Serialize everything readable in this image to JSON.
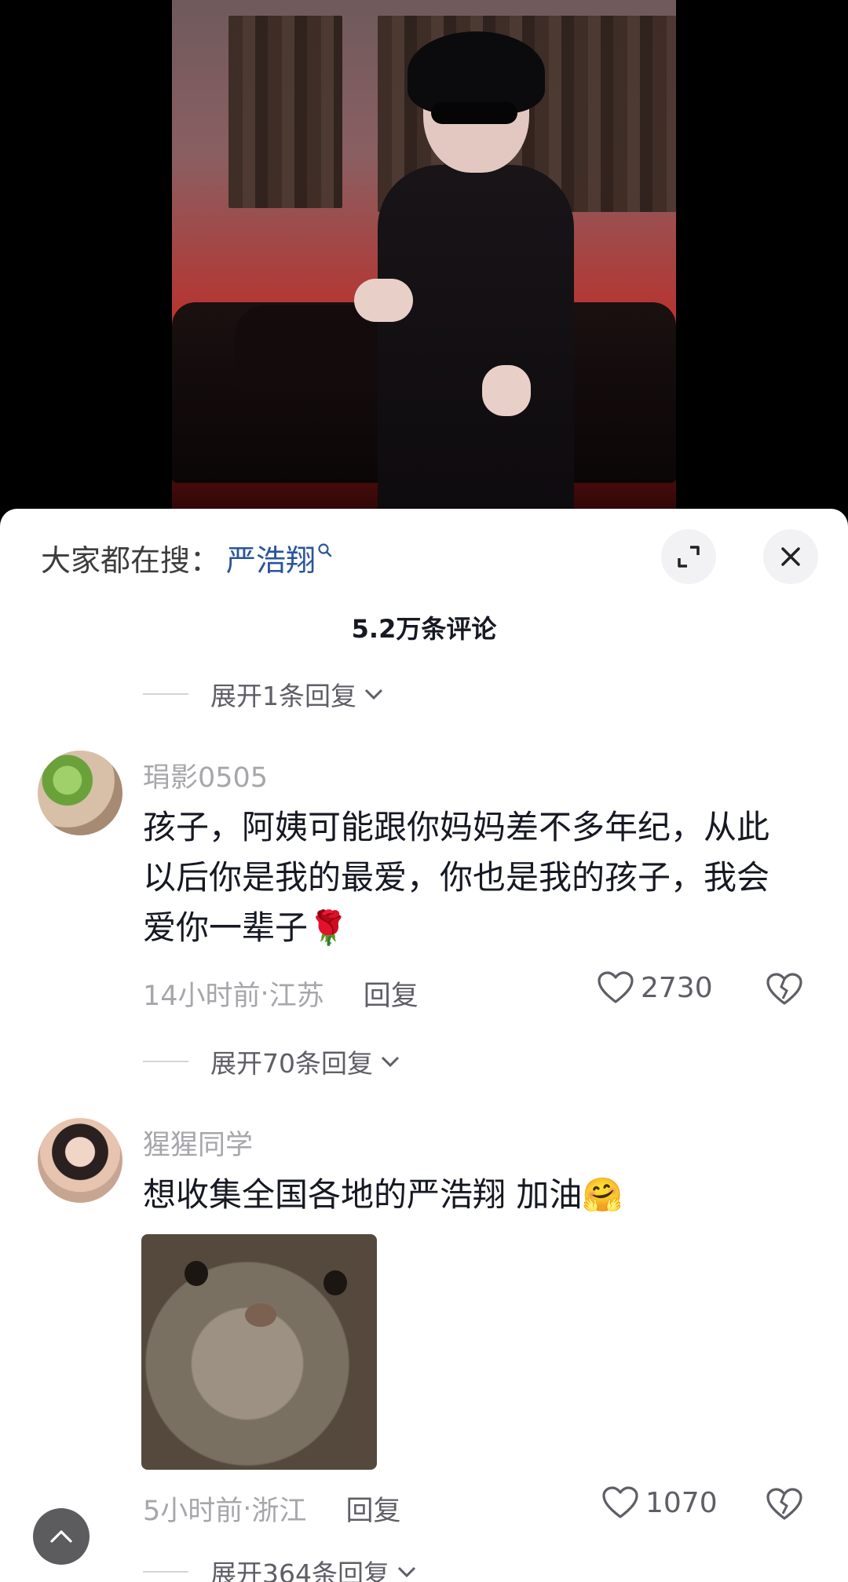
{
  "search": {
    "prefix": "大家都在搜：",
    "term": "严浩翔"
  },
  "comments_count": "5.2万条评论",
  "top_expand": "展开1条回复",
  "comments": [
    {
      "user": "琄影0505",
      "text": "孩子，阿姨可能跟你妈妈差不多年纪，从此以后你是我的最爱，你也是我的孩子，我会爱你一辈子🌹",
      "time": "14小时前",
      "location": "江苏",
      "reply_label": "回复",
      "likes": "2730",
      "expand": "展开70条回复"
    },
    {
      "user": "猩猩同学",
      "text": "想收集全国各地的严浩翔 加油🤗",
      "time": "5小时前",
      "location": "浙江",
      "reply_label": "回复",
      "likes": "1070",
      "expand": "展开364条回复"
    }
  ],
  "separator": " · ",
  "icons": [
    "search-icon",
    "expand-icon",
    "close-icon",
    "chevron-down-icon",
    "heart-icon",
    "broken-heart-icon",
    "chevron-up-icon"
  ]
}
